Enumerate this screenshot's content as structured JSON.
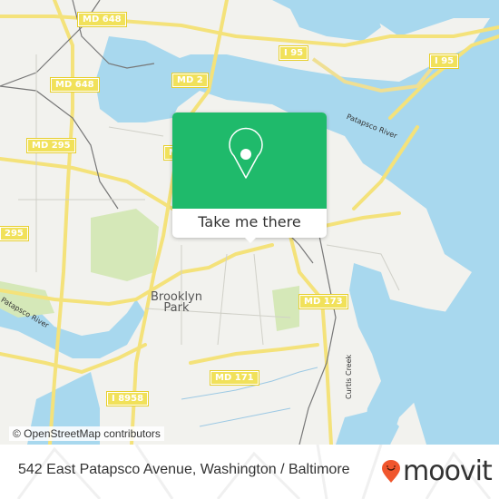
{
  "map": {
    "road_shields": [
      {
        "id": "md648-top",
        "label": "MD 648"
      },
      {
        "id": "md648-left",
        "label": "MD 648"
      },
      {
        "id": "md2",
        "label": "MD 2"
      },
      {
        "id": "i95-mid",
        "label": "I 95"
      },
      {
        "id": "i95-right",
        "label": "I 95"
      },
      {
        "id": "md295",
        "label": "MD 295"
      },
      {
        "id": "i295",
        "label": "295"
      },
      {
        "id": "md173",
        "label": "MD 173"
      },
      {
        "id": "md171",
        "label": "MD 171"
      },
      {
        "id": "i8958",
        "label": "I 8958"
      },
      {
        "id": "md-partial",
        "label": "M"
      }
    ],
    "place_labels": {
      "brooklyn_park": "Brooklyn\nPark",
      "patapsco_river_east": "Patapsco River",
      "patapsco_river_west": "Patapsco River",
      "curtis_creek": "Curtis Creek"
    },
    "attribution": "© OpenStreetMap contributors",
    "colors": {
      "water": "#a8d8ee",
      "land": "#f2f2ee",
      "park": "#d5e8b8",
      "road": "#f4e27a",
      "rail": "#777777"
    }
  },
  "popup": {
    "icon": "map-pin-icon",
    "button_label": "Take me there",
    "accent_color": "#1fba6b"
  },
  "footer": {
    "address": "542 East Patapsco Avenue, Washington / Baltimore",
    "brand": "moovit",
    "brand_icon": "moovit-pin-icon",
    "brand_color": "#f0562d"
  }
}
